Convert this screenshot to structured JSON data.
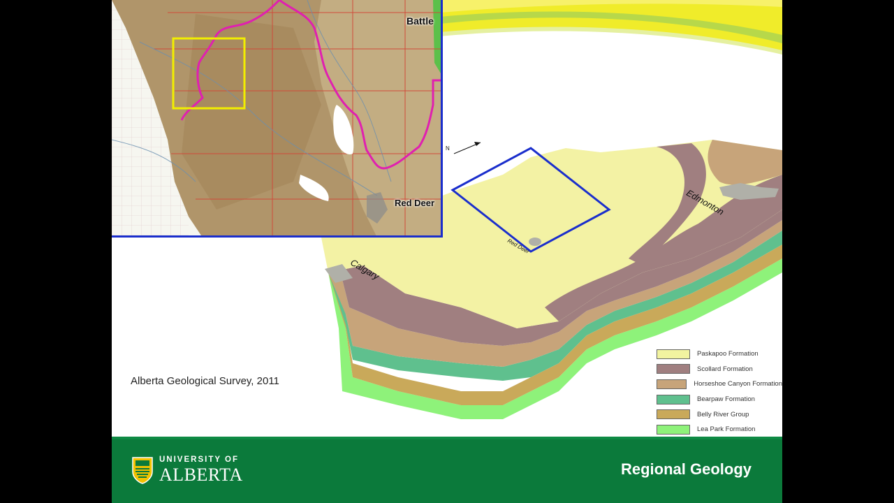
{
  "slide": {
    "title": "Regional Geology",
    "credit": "Alberta Geological Survey, 2011"
  },
  "inset_map": {
    "labels": {
      "battle": "Battle",
      "red_deer": "Red Deer"
    },
    "colors": {
      "boundary": "#e020b0",
      "selection_box": "#f2ee00",
      "frame": "#1a2ecc"
    }
  },
  "block_diagram": {
    "place_labels": {
      "edmonton": "Edmonton",
      "calgary": "Calgary",
      "red_deer": "Red Deer"
    },
    "north_arrow": "N"
  },
  "legend": [
    {
      "label": "Paskapoo Formation",
      "color": "#f2f3a0"
    },
    {
      "label": "Scollard Formation",
      "color": "#a07f80"
    },
    {
      "label": "Horseshoe Canyon Formation",
      "color": "#c7a47a"
    },
    {
      "label": "Bearpaw Formation",
      "color": "#5fc08e"
    },
    {
      "label": "Belly River Group",
      "color": "#c9a95a"
    },
    {
      "label": "Lea Park Formation",
      "color": "#8ef27a"
    }
  ],
  "footer": {
    "logo_line1": "UNIVERSITY OF",
    "logo_line2": "ALBERTA",
    "bg_color": "#0b7a3b"
  }
}
